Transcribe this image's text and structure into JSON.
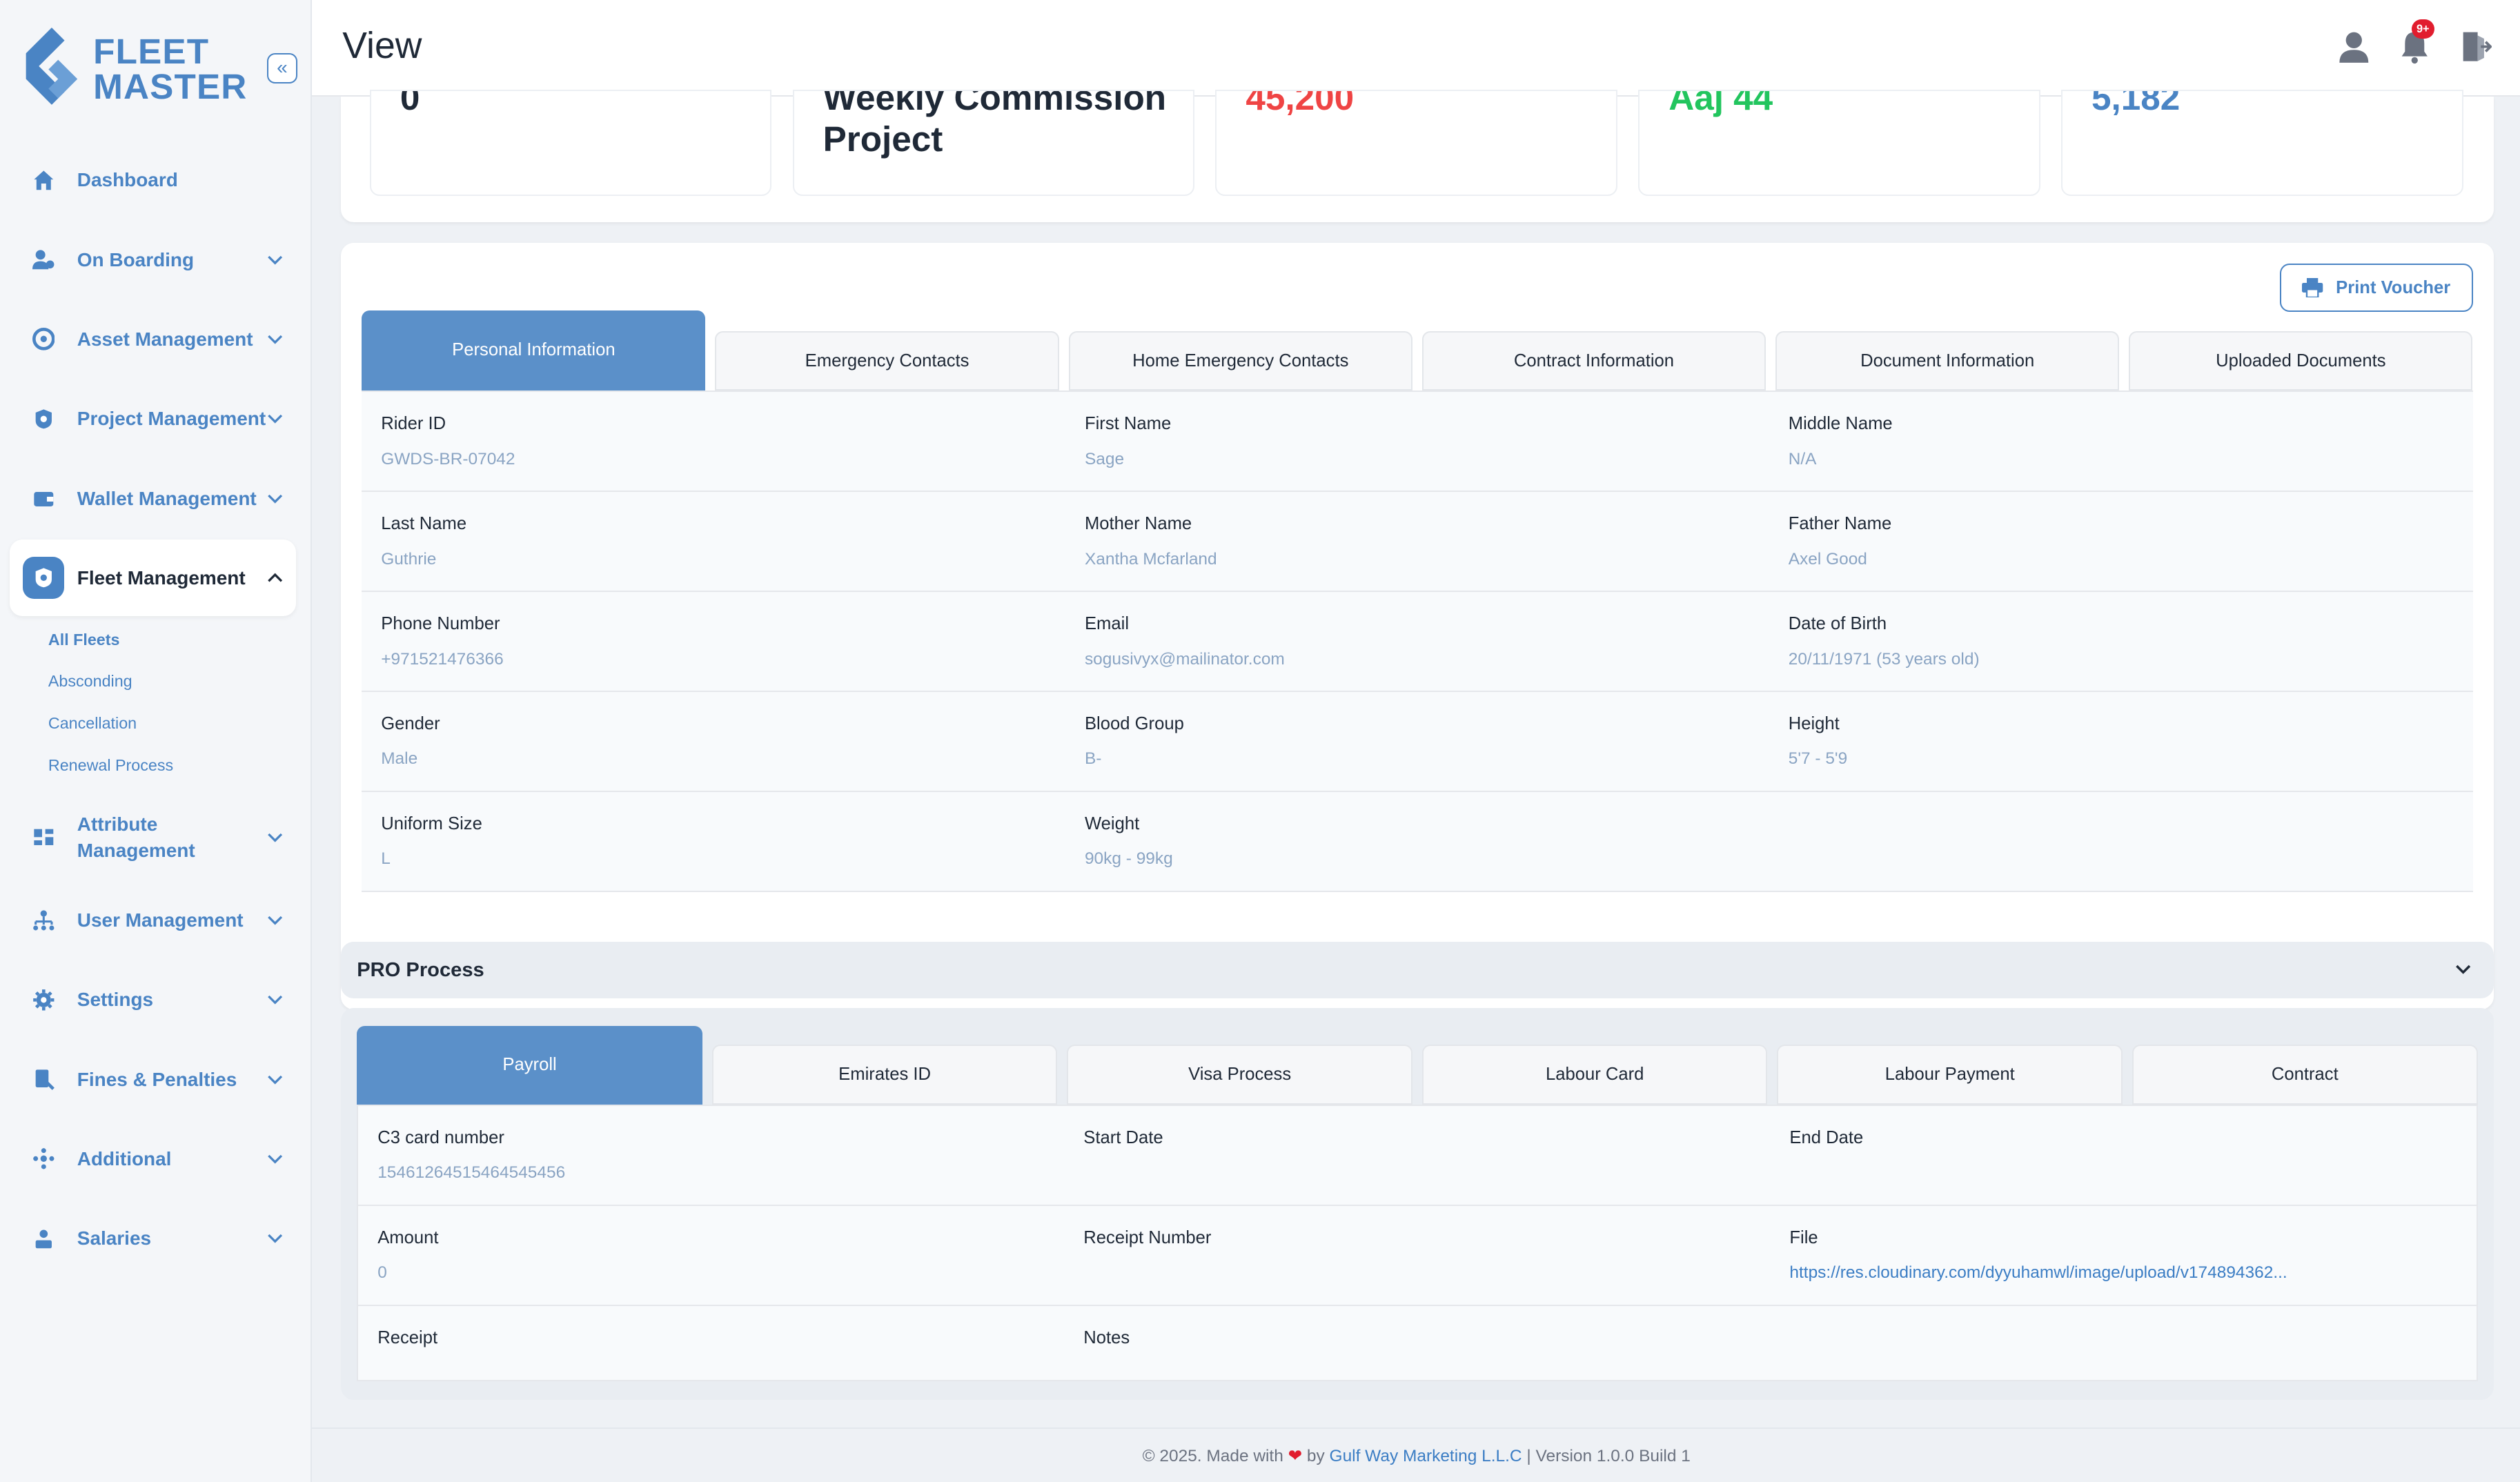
{
  "app": {
    "logo_line1": "FLEET",
    "logo_line2": "MASTER",
    "collapse_label": "«",
    "accent": "#4a84c4"
  },
  "sidebar": {
    "items": [
      {
        "label": "Dashboard",
        "icon": "home-icon"
      },
      {
        "label": "On Boarding",
        "icon": "user-onboarding-icon"
      },
      {
        "label": "Asset Management",
        "icon": "asset-icon"
      },
      {
        "label": "Project Management",
        "icon": "project-icon"
      },
      {
        "label": "Wallet Management",
        "icon": "wallet-icon"
      },
      {
        "label": "Fleet Management",
        "icon": "fleet-icon"
      },
      {
        "label": "Attribute Management",
        "icon": "attribute-icon"
      },
      {
        "label": "User Management",
        "icon": "user-tree-icon"
      },
      {
        "label": "Settings",
        "icon": "gear-icon"
      },
      {
        "label": "Fines & Penalties",
        "icon": "fines-icon"
      },
      {
        "label": "Additional",
        "icon": "additional-icon"
      },
      {
        "label": "Salaries",
        "icon": "salaries-icon"
      }
    ],
    "fleet_sub": [
      "All Fleets",
      "Absconding",
      "Cancellation",
      "Renewal Process"
    ]
  },
  "header": {
    "title": "View",
    "notification_count": "9+"
  },
  "stats": {
    "card2_line1": "Weekly Commission",
    "card2_line2": "Project",
    "card1_value": "0",
    "card3_value": "45,200",
    "card4_value": "Aaj 44",
    "card5_value": "5,182"
  },
  "personal": {
    "print_label": "Print Voucher",
    "tabs": [
      "Personal Information",
      "Emergency Contacts",
      "Home Emergency Contacts",
      "Contract Information",
      "Document Information",
      "Uploaded Documents"
    ],
    "rows": [
      [
        {
          "k": "Rider ID",
          "v": "GWDS-BR-07042"
        },
        {
          "k": "First Name",
          "v": "Sage"
        },
        {
          "k": "Middle Name",
          "v": "N/A"
        }
      ],
      [
        {
          "k": "Last Name",
          "v": "Guthrie"
        },
        {
          "k": "Mother Name",
          "v": "Xantha Mcfarland"
        },
        {
          "k": "Father Name",
          "v": "Axel Good"
        }
      ],
      [
        {
          "k": "Phone Number",
          "v": "+971521476366"
        },
        {
          "k": "Email",
          "v": "sogusivyx@mailinator.com"
        },
        {
          "k": "Date of Birth",
          "v": "20/11/1971 (53 years old)"
        }
      ],
      [
        {
          "k": "Gender",
          "v": "Male"
        },
        {
          "k": "Blood Group",
          "v": "B-"
        },
        {
          "k": "Height",
          "v": "5'7 - 5'9"
        }
      ],
      [
        {
          "k": "Uniform Size",
          "v": "L"
        },
        {
          "k": "Weight",
          "v": "90kg - 99kg"
        },
        {
          "k": "",
          "v": ""
        }
      ]
    ]
  },
  "pro": {
    "title": "PRO Process",
    "tabs": [
      "Payroll",
      "Emirates ID",
      "Visa Process",
      "Labour Card",
      "Labour Payment",
      "Contract"
    ],
    "rows": [
      [
        {
          "k": "C3 card number",
          "v": "15461264515464545456"
        },
        {
          "k": "Start Date",
          "v": ""
        },
        {
          "k": "End Date",
          "v": ""
        }
      ],
      [
        {
          "k": "Amount",
          "v": "0"
        },
        {
          "k": "Receipt Number",
          "v": ""
        },
        {
          "k": "File",
          "v": "https://res.cloudinary.com/dyyuhamwl/image/upload/v174894362..."
        }
      ],
      [
        {
          "k": "Receipt",
          "v": ""
        },
        {
          "k": "Notes",
          "v": ""
        },
        {
          "k": "",
          "v": ""
        }
      ]
    ]
  },
  "footer": {
    "prefix": "© 2025. Made with",
    "by": "by",
    "company": "Gulf Way Marketing L.L.C",
    "suffix": "| Version 1.0.0 Build 1"
  }
}
